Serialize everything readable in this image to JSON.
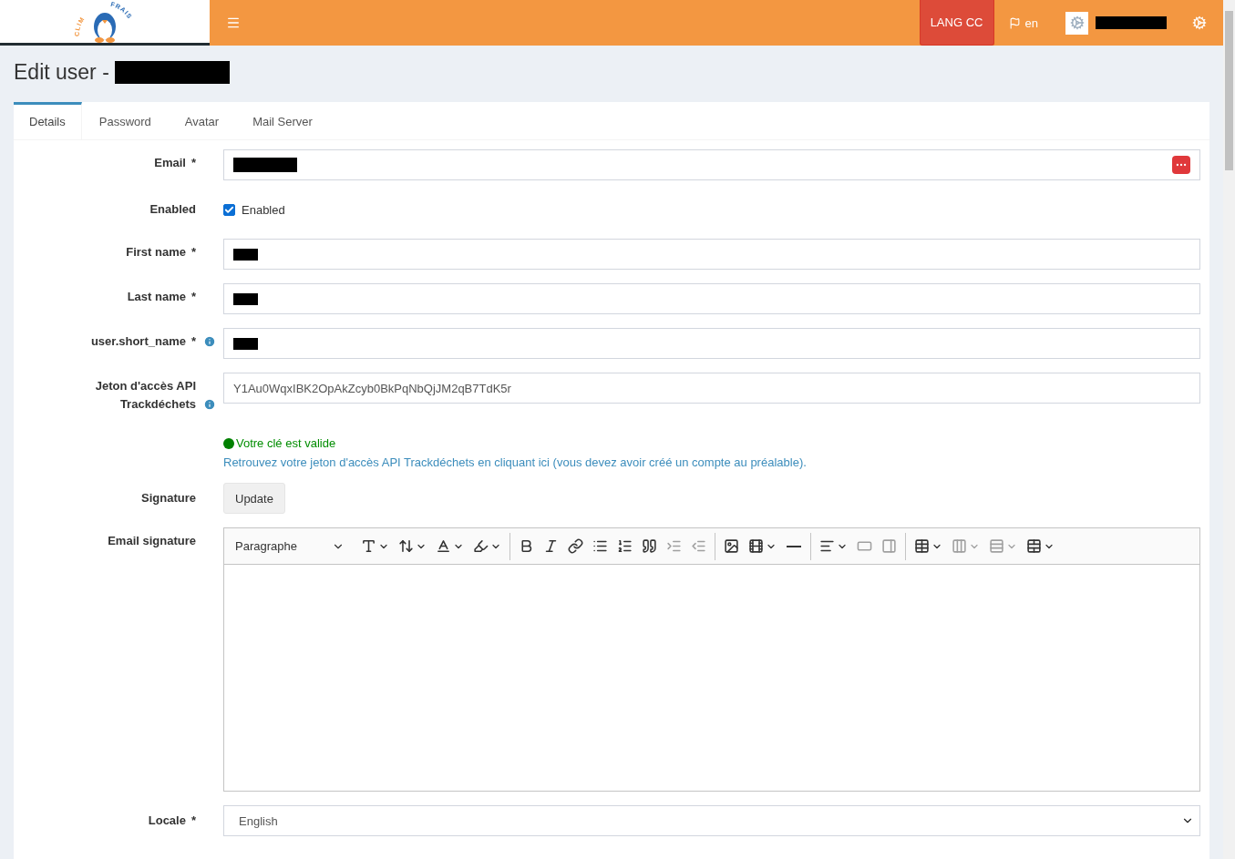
{
  "logo": {
    "left": "CLIM",
    "right": "FRAIS"
  },
  "header": {
    "lang_button": "LANG CC",
    "language": "en",
    "user_redacted": true
  },
  "page_title": {
    "text": "Edit user -",
    "redacted": true
  },
  "tabs": [
    {
      "label": "Details",
      "selected": true
    },
    {
      "label": "Password",
      "selected": false
    },
    {
      "label": "Avatar",
      "selected": false
    },
    {
      "label": "Mail Server",
      "selected": false
    }
  ],
  "fields": [
    {
      "kind": "text",
      "label": "Email",
      "required_mark": "*",
      "redacted": true,
      "password_manager": true
    },
    {
      "kind": "checkbox",
      "label": "Enabled",
      "checkbox_label": "Enabled",
      "checked": true
    },
    {
      "kind": "text",
      "label": "First name",
      "required_mark": "*",
      "redacted": true
    },
    {
      "kind": "text",
      "label": "Last name",
      "required_mark": "*",
      "redacted": true
    },
    {
      "kind": "text",
      "label": "user.short_name",
      "required_mark": "*",
      "info": true,
      "redacted": true
    },
    {
      "kind": "text",
      "label": "Jeton d'accès API Trackdéchets",
      "info": true,
      "value": "Y1Au0WqxIBK2OpAkZcyb0BkPqNbQjJM2qB7TdK5r"
    },
    {
      "kind": "messages",
      "valid": "Votre clé est valide",
      "help_link": "Retrouvez votre jeton d'accès API Trackdéchets en cliquant ici (vous devez avoir créé un compte au préalable)."
    },
    {
      "kind": "button",
      "label": "Signature",
      "button": "Update"
    },
    {
      "kind": "editor",
      "label": "Email signature"
    },
    {
      "kind": "select",
      "label": "Locale",
      "required_mark": "*",
      "value": "English"
    }
  ],
  "editor_toolbar": [
    {
      "kind": "select",
      "label": "Paragraphe"
    },
    {
      "kind": "button",
      "caret": true,
      "disabled": false
    },
    {
      "kind": "button",
      "caret": true,
      "disabled": false
    },
    {
      "kind": "button",
      "caret": true,
      "disabled": false
    },
    {
      "kind": "button",
      "caret": true,
      "disabled": false
    },
    {
      "kind": "separator"
    },
    {
      "kind": "button",
      "disabled": false
    },
    {
      "kind": "button",
      "disabled": false
    },
    {
      "kind": "button",
      "disabled": false
    },
    {
      "kind": "button",
      "disabled": false
    },
    {
      "kind": "button",
      "disabled": false
    },
    {
      "kind": "button",
      "disabled": false
    },
    {
      "kind": "button",
      "disabled": true
    },
    {
      "kind": "button",
      "disabled": true
    },
    {
      "kind": "separator"
    },
    {
      "kind": "button",
      "disabled": false
    },
    {
      "kind": "button",
      "caret": true,
      "disabled": false
    },
    {
      "kind": "button",
      "disabled": false
    },
    {
      "kind": "separator"
    },
    {
      "kind": "button",
      "caret": true,
      "disabled": false
    },
    {
      "kind": "button",
      "disabled": true
    },
    {
      "kind": "button",
      "disabled": true
    },
    {
      "kind": "separator"
    },
    {
      "kind": "button",
      "caret": true,
      "disabled": false
    },
    {
      "kind": "button",
      "caret": true,
      "disabled": true
    },
    {
      "kind": "button",
      "caret": true,
      "disabled": true
    },
    {
      "kind": "button",
      "caret": true,
      "disabled": false
    }
  ]
}
